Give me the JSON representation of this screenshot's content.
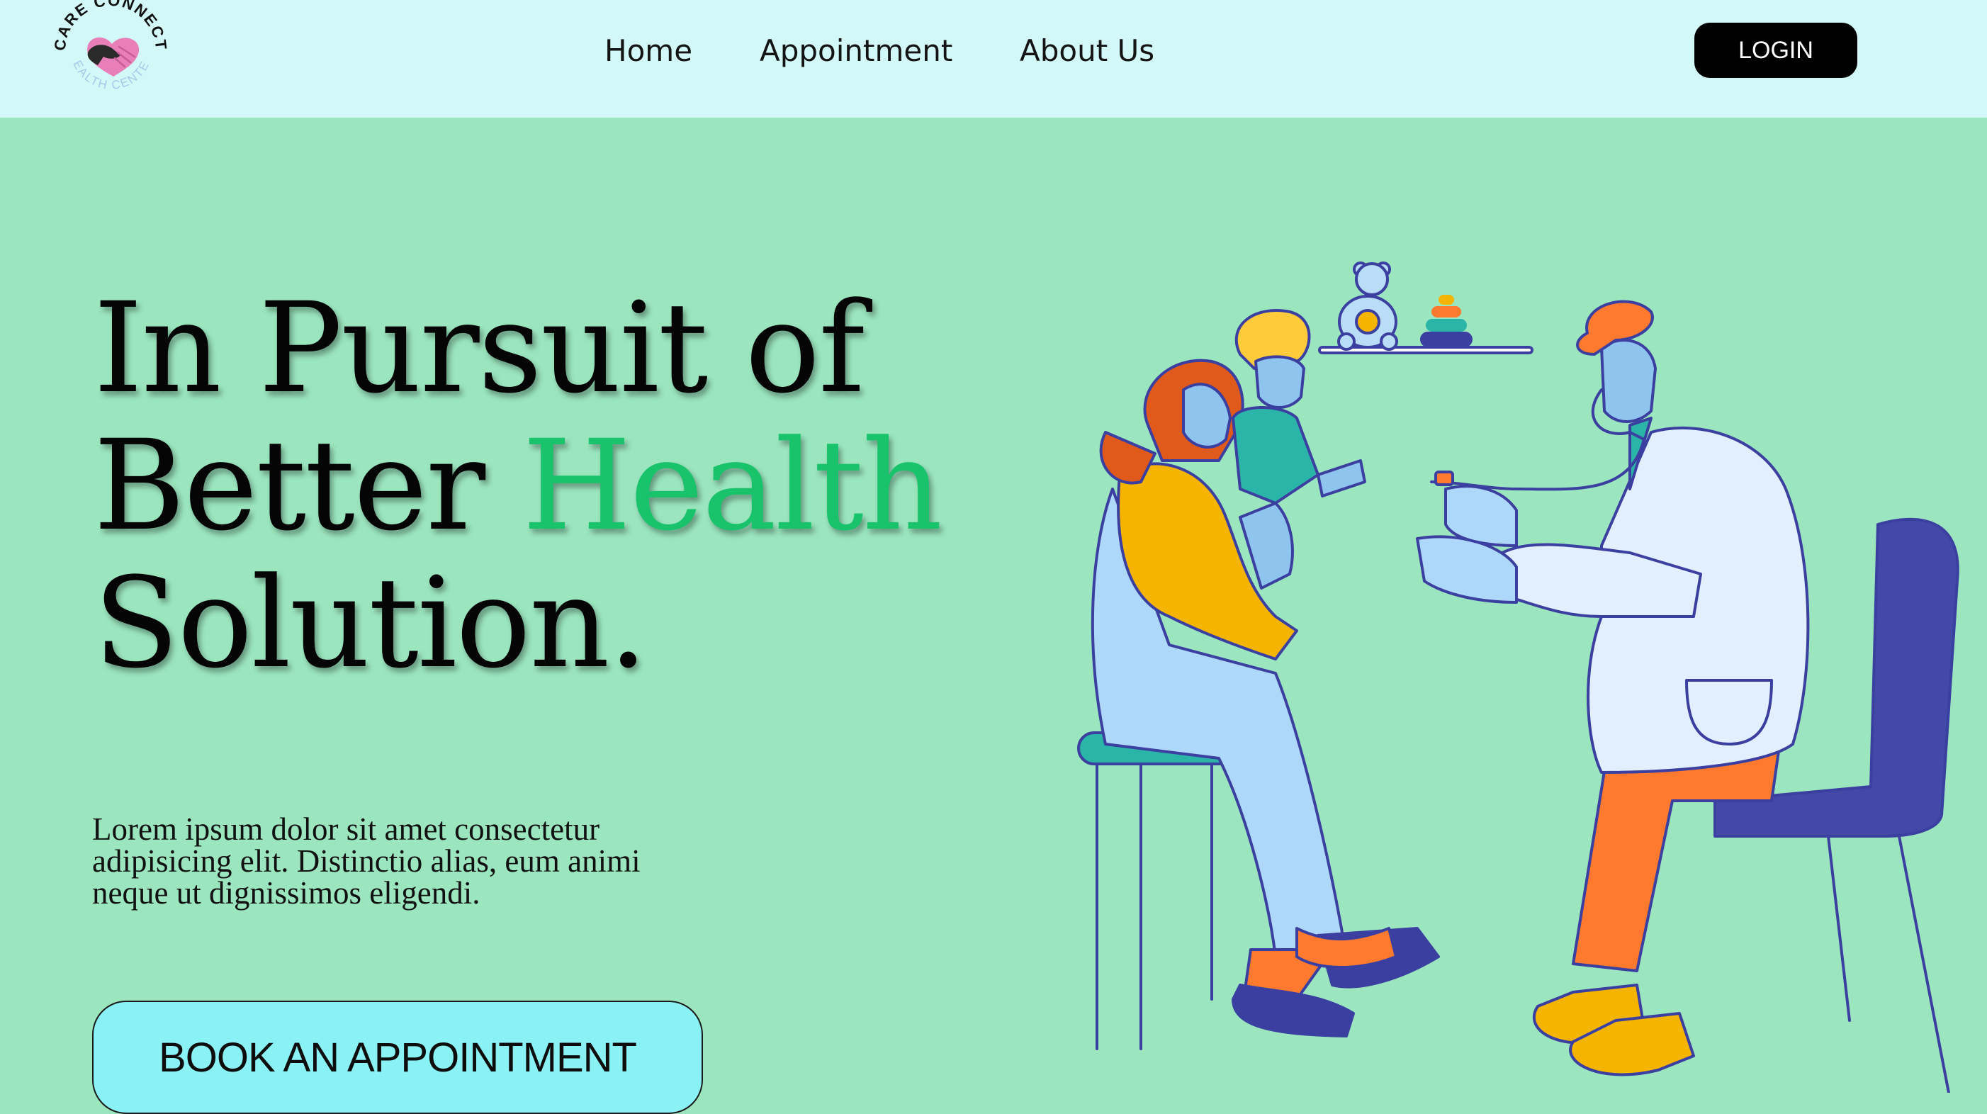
{
  "brand": {
    "name_top": "CARE CONNECT",
    "name_bottom": "HEALTH CENTER",
    "colors": {
      "heart": "#E97FB8",
      "hand": "#2A2A2A",
      "subtext": "#A7C9E8"
    }
  },
  "nav": {
    "links": [
      "Home",
      "Appointment",
      "About Us"
    ],
    "login_label": "LOGIN"
  },
  "hero": {
    "title_line1": "In Pursuit of",
    "title_line2_a": "Better ",
    "title_line2_b": "Health",
    "title_line3": "Solution.",
    "description": "Lorem ipsum dolor sit amet consectetur adipisicing elit. Distinctio alias, eum animi neque ut dignissimos eligendi.",
    "cta_label": "BOOK AN APPOINTMENT"
  },
  "illustration": {
    "subject": "doctor-examining-child-illustration"
  },
  "colors": {
    "page_bg": "#9BE6BF",
    "navbar_bg": "#D3F8F8",
    "accent": "#18C36B",
    "cta_bg": "#8AF2F4",
    "login_bg": "#000000"
  }
}
